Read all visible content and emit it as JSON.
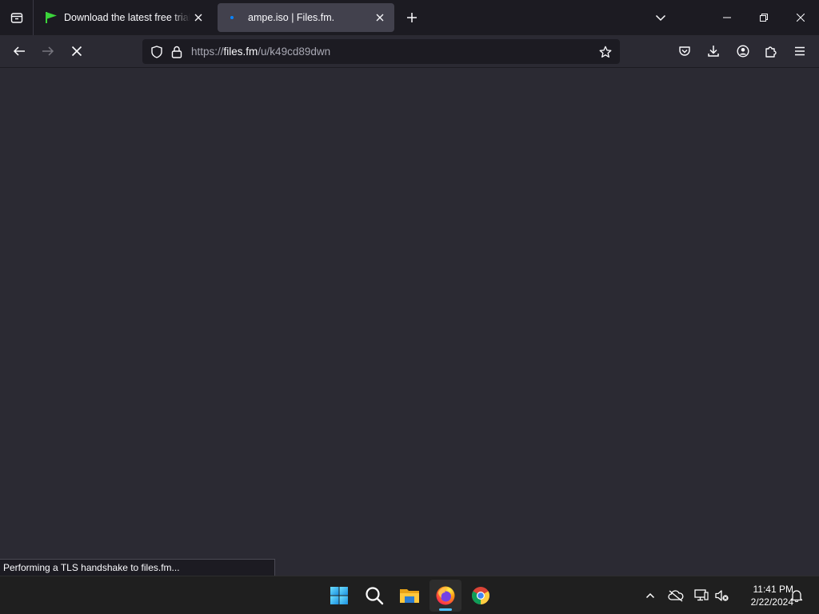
{
  "browser": {
    "tabs": [
      {
        "title": "Download the latest free trial version",
        "active": false,
        "favicon": "green-flag-icon"
      },
      {
        "title": "ampe.iso | Files.fm.",
        "active": true,
        "favicon": "loading-dot-icon"
      }
    ],
    "url": {
      "scheme": "https://",
      "host": "files.fm",
      "path": "/u/k49cd89dwn"
    },
    "status_text": "Performing a TLS handshake to files.fm...",
    "loading": true
  },
  "taskbar": {
    "pinned": [
      {
        "name": "start-button",
        "icon": "windows-logo-icon"
      },
      {
        "name": "search-button",
        "icon": "search-icon"
      },
      {
        "name": "file-explorer",
        "icon": "folder-icon"
      },
      {
        "name": "firefox",
        "icon": "firefox-icon",
        "active": true
      },
      {
        "name": "chrome",
        "icon": "chrome-icon"
      }
    ],
    "clock": {
      "time": "11:41 PM",
      "date": "2/22/2024"
    }
  },
  "colors": {
    "chrome_bg": "#1c1b22",
    "toolbar_bg": "#2b2a33",
    "active_tab": "#42414d",
    "accent": "#4cc2ff"
  }
}
